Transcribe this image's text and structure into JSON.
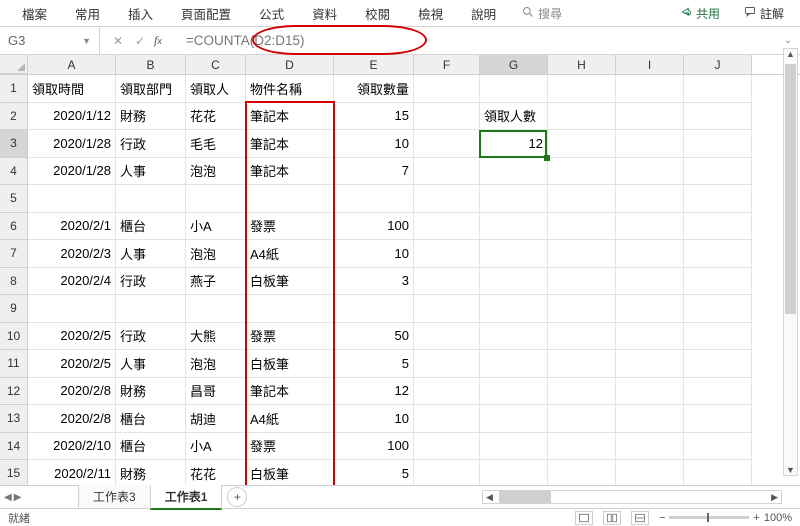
{
  "ribbon": {
    "tabs": [
      "檔案",
      "常用",
      "插入",
      "頁面配置",
      "公式",
      "資料",
      "校閱",
      "檢視",
      "說明"
    ],
    "search_placeholder": "搜尋",
    "share_label": "共用",
    "comment_label": "註解"
  },
  "formula_bar": {
    "name_box": "G3",
    "formula": "=COUNTA(D2:D15)"
  },
  "columns": [
    "A",
    "B",
    "C",
    "D",
    "E",
    "F",
    "G",
    "H",
    "I",
    "J"
  ],
  "selected_column": "G",
  "selected_row": 3,
  "headers": {
    "A": "領取時間",
    "B": "領取部門",
    "C": "領取人",
    "D": "物件名稱",
    "E": "領取數量"
  },
  "side": {
    "G2": "領取人數",
    "G3": "12"
  },
  "rows": [
    {
      "n": 1,
      "A": "領取時間",
      "B": "領取部門",
      "C": "領取人",
      "D": "物件名稱",
      "E": "領取數量"
    },
    {
      "n": 2,
      "A": "2020/1/12",
      "B": "財務",
      "C": "花花",
      "D": "筆記本",
      "E": "15",
      "G": "領取人數"
    },
    {
      "n": 3,
      "A": "2020/1/28",
      "B": "行政",
      "C": "毛毛",
      "D": "筆記本",
      "E": "10",
      "G": "12"
    },
    {
      "n": 4,
      "A": "2020/1/28",
      "B": "人事",
      "C": "泡泡",
      "D": "筆記本",
      "E": "7"
    },
    {
      "n": 5
    },
    {
      "n": 6,
      "A": "2020/2/1",
      "B": "櫃台",
      "C": "小A",
      "D": "發票",
      "E": "100"
    },
    {
      "n": 7,
      "A": "2020/2/3",
      "B": "人事",
      "C": "泡泡",
      "D": "A4紙",
      "E": "10"
    },
    {
      "n": 8,
      "A": "2020/2/4",
      "B": "行政",
      "C": "燕子",
      "D": "白板筆",
      "E": "3"
    },
    {
      "n": 9
    },
    {
      "n": 10,
      "A": "2020/2/5",
      "B": "行政",
      "C": "大熊",
      "D": "發票",
      "E": "50"
    },
    {
      "n": 11,
      "A": "2020/2/5",
      "B": "人事",
      "C": "泡泡",
      "D": "白板筆",
      "E": "5"
    },
    {
      "n": 12,
      "A": "2020/2/8",
      "B": "財務",
      "C": "昌哥",
      "D": "筆記本",
      "E": "12"
    },
    {
      "n": 13,
      "A": "2020/2/8",
      "B": "櫃台",
      "C": "胡迪",
      "D": "A4紙",
      "E": "10"
    },
    {
      "n": 14,
      "A": "2020/2/10",
      "B": "櫃台",
      "C": "小A",
      "D": "發票",
      "E": "100"
    },
    {
      "n": 15,
      "A": "2020/2/11",
      "B": "財務",
      "C": "花花",
      "D": "白板筆",
      "E": "5"
    }
  ],
  "sheets": {
    "tabs": [
      "工作表3",
      "工作表1"
    ],
    "active_index": 1
  },
  "status": {
    "ready": "就緒",
    "zoom": "100%"
  }
}
